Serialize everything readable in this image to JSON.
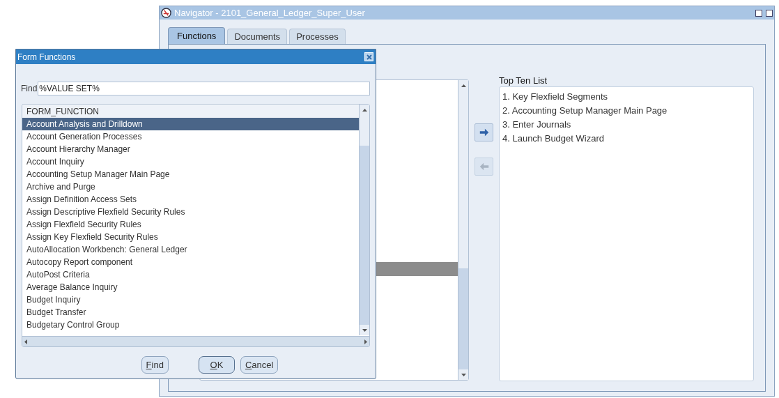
{
  "navigator": {
    "title": "Navigator - 2101_General_Ledger_Super_User",
    "tabs": [
      {
        "label": "Functions",
        "selected": true
      },
      {
        "label": "Documents",
        "selected": false
      },
      {
        "label": "Processes",
        "selected": false
      }
    ],
    "move_buttons": [
      {
        "kind": "right",
        "disabled": false
      },
      {
        "kind": "left",
        "disabled": true
      }
    ],
    "top_ten": {
      "label": "Top Ten List",
      "items": [
        "1. Key Flexfield Segments",
        "2. Accounting Setup Manager Main Page",
        "3. Enter Journals",
        "4. Launch Budget Wizard"
      ]
    }
  },
  "dialog": {
    "title": "Form Functions",
    "find_label": "Find",
    "find_value": "%VALUE SET%",
    "list": {
      "header": "FORM_FUNCTION",
      "rows": [
        {
          "label": "Account Analysis and Drilldown",
          "selected": true
        },
        {
          "label": "Account Generation Processes",
          "selected": false
        },
        {
          "label": "Account Hierarchy Manager",
          "selected": false
        },
        {
          "label": "Account Inquiry",
          "selected": false
        },
        {
          "label": "Accounting Setup Manager Main Page",
          "selected": false
        },
        {
          "label": "Archive and Purge",
          "selected": false
        },
        {
          "label": "Assign Definition Access Sets",
          "selected": false
        },
        {
          "label": "Assign Descriptive Flexfield Security Rules",
          "selected": false
        },
        {
          "label": "Assign Flexfield Security Rules",
          "selected": false
        },
        {
          "label": "Assign Key Flexfield Security Rules",
          "selected": false
        },
        {
          "label": "AutoAllocation Workbench: General Ledger",
          "selected": false
        },
        {
          "label": "Autocopy Report component",
          "selected": false
        },
        {
          "label": "AutoPost Criteria",
          "selected": false
        },
        {
          "label": "Average Balance Inquiry",
          "selected": false
        },
        {
          "label": "Budget Inquiry",
          "selected": false
        },
        {
          "label": "Budget Transfer",
          "selected": false
        },
        {
          "label": "Budgetary Control Group",
          "selected": false
        }
      ]
    },
    "buttons": [
      {
        "label": "Find",
        "default": false
      },
      {
        "label": "OK",
        "default": true
      },
      {
        "label": "Cancel",
        "default": false
      }
    ]
  }
}
